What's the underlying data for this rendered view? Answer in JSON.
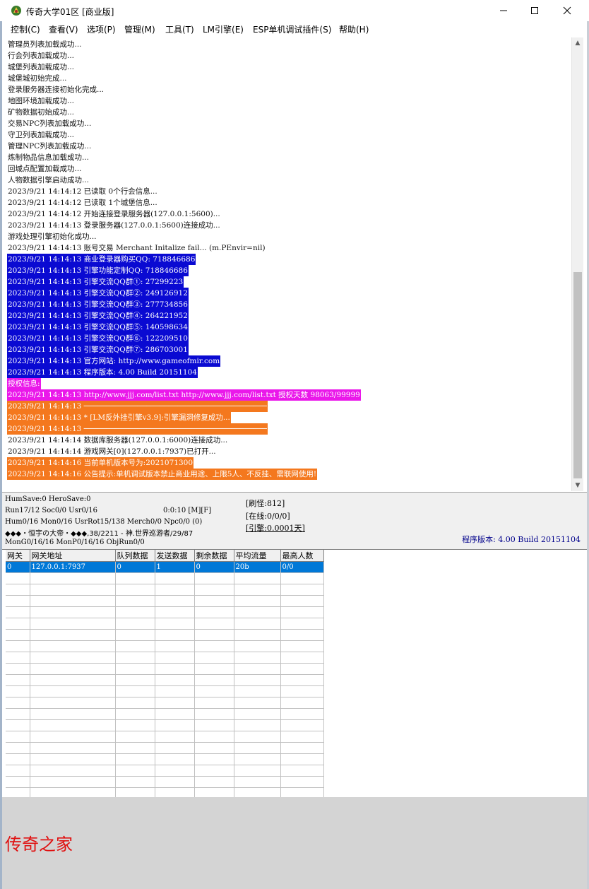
{
  "window": {
    "title": "传奇大学01区 [商业版]"
  },
  "menu": [
    "控制(C)",
    "查看(V)",
    "选项(P)",
    "管理(M)",
    "工具(T)",
    "LM引擎(E)",
    "ESP单机调试插件(S)",
    "帮助(H)"
  ],
  "log": [
    {
      "text": "管理员列表加载成功...",
      "style": "plain"
    },
    {
      "text": "行会列表加载成功...",
      "style": "plain"
    },
    {
      "text": "城堡列表加载成功...",
      "style": "plain"
    },
    {
      "text": "城堡城初始完成...",
      "style": "plain"
    },
    {
      "text": "登录服务器连接初始化完成...",
      "style": "plain"
    },
    {
      "text": "地图环境加载成功...",
      "style": "plain"
    },
    {
      "text": "矿物数据初始成功...",
      "style": "plain"
    },
    {
      "text": "交易NPC列表加载成功...",
      "style": "plain"
    },
    {
      "text": "守卫列表加载成功...",
      "style": "plain"
    },
    {
      "text": "管理NPC列表加载成功...",
      "style": "plain"
    },
    {
      "text": "炼制物品信息加载成功...",
      "style": "plain"
    },
    {
      "text": "回城点配置加载成功...",
      "style": "plain"
    },
    {
      "text": "人物数据引擎启动成功...",
      "style": "plain"
    },
    {
      "text": "2023/9/21 14:14:12 已读取 0个行会信息...",
      "style": "plain"
    },
    {
      "text": "2023/9/21 14:14:12 已读取 1个城堡信息...",
      "style": "plain"
    },
    {
      "text": "2023/9/21 14:14:12 开始连接登录服务器(127.0.0.1:5600)...",
      "style": "plain"
    },
    {
      "text": "2023/9/21 14:14:13 登录服务器(127.0.0.1:5600)连接成功...",
      "style": "plain"
    },
    {
      "text": "游戏处理引擎初始化成功...",
      "style": "plain"
    },
    {
      "text": "2023/9/21 14:14:13 账号交易 Merchant Initalize fail... (m.PEnvir=nil)",
      "style": "plain"
    },
    {
      "text": "2023/9/21 14:14:13 商业登录器购买QQ: 718846686",
      "style": "blue"
    },
    {
      "text": "2023/9/21 14:14:13 引擎功能定制QQ: 718846686",
      "style": "blue"
    },
    {
      "text": "2023/9/21 14:14:13 引擎交流QQ群①: 27299223",
      "style": "blue"
    },
    {
      "text": "2023/9/21 14:14:13 引擎交流QQ群②: 249126912",
      "style": "blue"
    },
    {
      "text": "2023/9/21 14:14:13 引擎交流QQ群③: 277734856",
      "style": "blue"
    },
    {
      "text": "2023/9/21 14:14:13 引擎交流QQ群④: 264221952",
      "style": "blue"
    },
    {
      "text": "2023/9/21 14:14:13 引擎交流QQ群⑤: 140598634",
      "style": "blue"
    },
    {
      "text": "2023/9/21 14:14:13 引擎交流QQ群⑥: 122209510",
      "style": "blue"
    },
    {
      "text": "2023/9/21 14:14:13 引擎交流QQ群⑦: 286703001",
      "style": "blue"
    },
    {
      "text": "2023/9/21 14:14:13 官方网站: http://www.gameofmir.com",
      "style": "blue"
    },
    {
      "text": "2023/9/21 14:14:13 程序版本: 4.00 Build 20151104",
      "style": "blue"
    },
    {
      "text": "授权信息:",
      "style": "mag"
    },
    {
      "text": "2023/9/21 14:14:13 http://www.jjj.com/list.txt http://www.jjj.com/list.txt 授权天数 98063/99999",
      "style": "mag"
    },
    {
      "text": "2023/9/21 14:14:13 ─────────────────────────────────────────",
      "style": "org"
    },
    {
      "text": "2023/9/21 14:14:13 * [LM反外挂引擎v3.9]:引擎漏洞修复成功...",
      "style": "org"
    },
    {
      "text": "2023/9/21 14:14:13 ─────────────────────────────────────────",
      "style": "org"
    },
    {
      "text": "2023/9/21 14:14:14 数据库服务器(127.0.0.1:6000)连接成功...",
      "style": "plain"
    },
    {
      "text": "2023/9/21 14:14:14 游戏网关[0](127.0.0.1:7937)已打开...",
      "style": "plain"
    },
    {
      "text": "2023/9/21 14:14:16 当前单机版本号为:2021071300",
      "style": "org"
    },
    {
      "text": "2023/9/21 14:14:16 公告提示:单机调试版本禁止商业用途、上限5人、不反挂、需联网使用!",
      "style": "org"
    }
  ],
  "status": {
    "line1": "HumSave:0 HeroSave:0",
    "line2a": "Run17/12 Soc0/0 Usr0/16",
    "line2b": "0:0:10 [M][F]",
    "line3": "Hum0/16 Mon0/16 UsrRot15/138 Merch0/0 Npc0/0 (0)",
    "line4": "◆◆◆・恒宇の大帝・◆◆◆,38/2211 - 神.世界巡游者/29/87",
    "line5": "MonG0/16/16 MonP0/16/16 ObjRun0/0",
    "refresh": "[刷怪:812]",
    "online": "[在线:0/0/0]",
    "engine": "[引擎:0.0001天]",
    "version": "程序版本: 4.00 Build 20151104"
  },
  "grid": {
    "columns": [
      "网关",
      "网关地址",
      "队列数据",
      "发送数据",
      "剩余数据",
      "平均流量",
      "最高人数"
    ],
    "rows": [
      [
        "0",
        "127.0.0.1:7937",
        "0",
        "1",
        "0",
        "20b",
        "0/0"
      ]
    ]
  },
  "watermark": "传奇之家"
}
